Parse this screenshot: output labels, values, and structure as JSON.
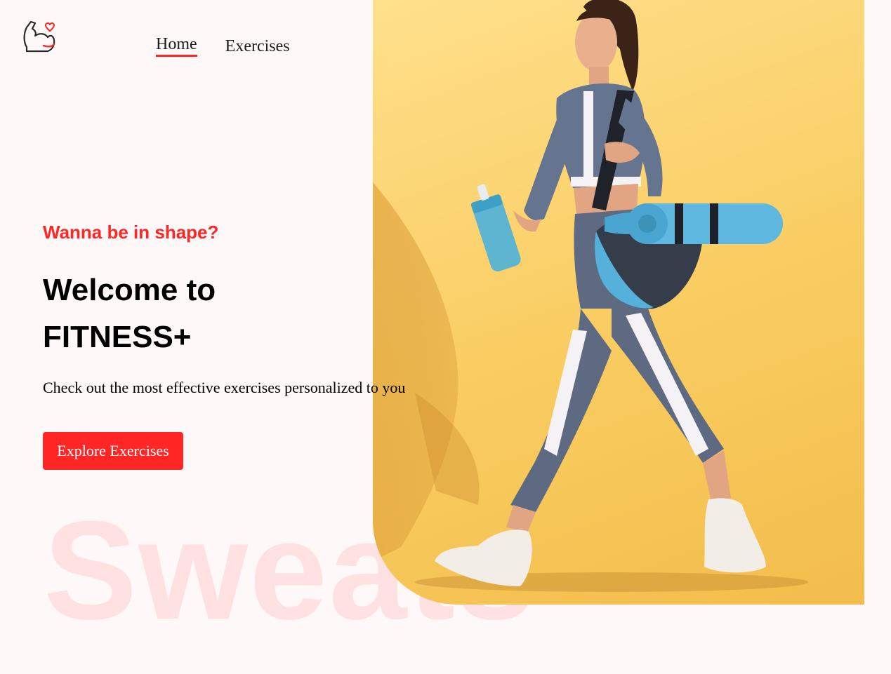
{
  "nav": {
    "logo_icon": "flexed-bicep-heart-icon",
    "items": [
      {
        "label": "Home",
        "active": true
      },
      {
        "label": "Exercises",
        "active": false
      }
    ]
  },
  "hero": {
    "tagline": "Wanna be in shape?",
    "headline_line1": "Welcome to",
    "headline_line2": "FITNESS+",
    "subtext": "Check out the most effective exercises personalized to you",
    "cta_label": "Explore Exercises",
    "watermark": "Sweats",
    "image_subject": "woman-walking-with-yoga-mat-and-water-bottle"
  },
  "colors": {
    "accent": "#ff2625",
    "background": "#fff8f8",
    "hero_image_background": "#f9cc60",
    "text": "#000000"
  }
}
